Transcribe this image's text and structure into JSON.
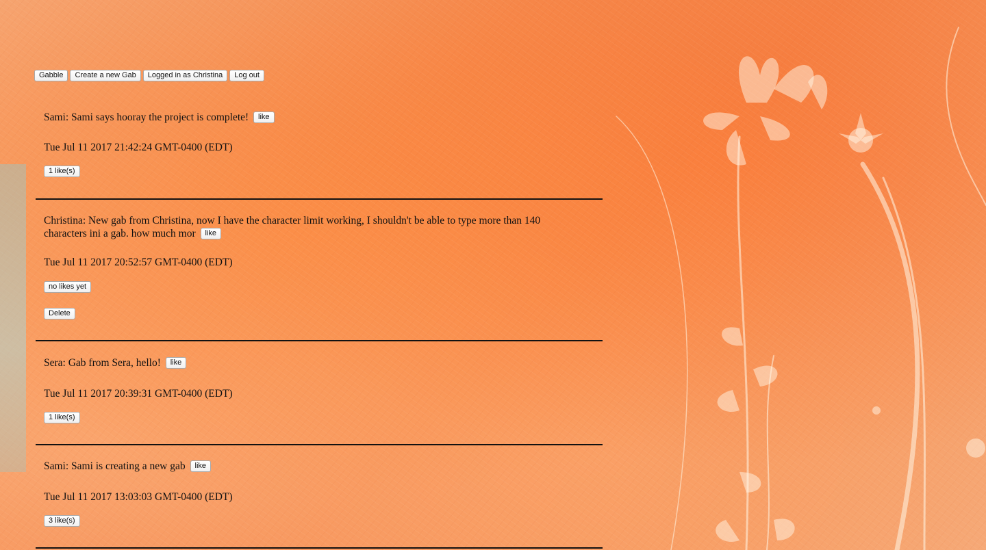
{
  "nav": {
    "home_label": "Gabble",
    "create_label": "Create a new Gab",
    "user_label": "Logged in as Christina",
    "logout_label": "Log out"
  },
  "gabs": [
    {
      "text": "Sami: Sami says hooray the project is complete!",
      "like_label": "like",
      "date": "Tue Jul 11 2017 21:42:24 GMT-0400 (EDT)",
      "likes_label": "1 like(s)"
    },
    {
      "text": "Christina: New gab from Christina, now I have the character limit working, I shouldn't be able to type more than 140 characters ini a gab. how much mor",
      "like_label": "like",
      "date": "Tue Jul 11 2017 20:52:57 GMT-0400 (EDT)",
      "likes_label": "no likes yet",
      "delete_label": "Delete"
    },
    {
      "text": "Sera: Gab from Sera, hello!",
      "like_label": "like",
      "date": "Tue Jul 11 2017 20:39:31 GMT-0400 (EDT)",
      "likes_label": "1 like(s)"
    },
    {
      "text": "Sami: Sami is creating a new gab",
      "like_label": "like",
      "date": "Tue Jul 11 2017 13:03:03 GMT-0400 (EDT)",
      "likes_label": "3 like(s)"
    }
  ]
}
